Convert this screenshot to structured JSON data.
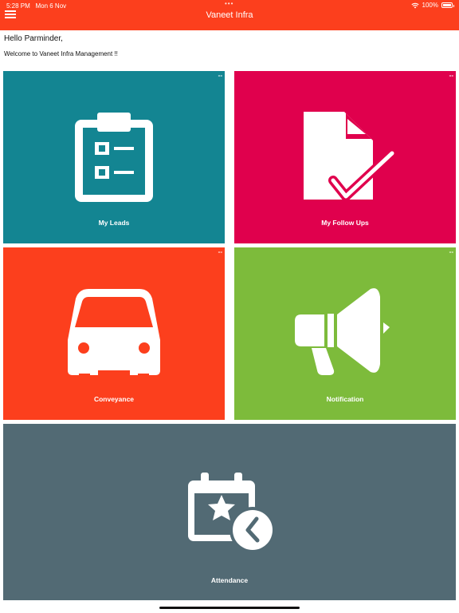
{
  "status_bar": {
    "time": "5:28 PM",
    "date": "Mon 6 Nov",
    "battery": "100%",
    "dots": "•••"
  },
  "header": {
    "title": "Vaneet Infra",
    "color": "#fc3f1d"
  },
  "greeting": {
    "hello": "Hello Parminder,",
    "welcome": "Welcome to Vaneet Infra Management !!"
  },
  "tiles": [
    {
      "label": "My Leads",
      "badge": "--",
      "color": "#138592",
      "icon": "clipboard-checklist-icon"
    },
    {
      "label": "My Follow Ups",
      "badge": "--",
      "color": "#e0004d",
      "icon": "document-check-icon"
    },
    {
      "label": "Conveyance",
      "badge": "--",
      "color": "#fc3f1d",
      "icon": "vehicle-icon"
    },
    {
      "label": "Notification",
      "badge": "--",
      "color": "#7dbb3b",
      "icon": "megaphone-icon"
    },
    {
      "label": "Attendance",
      "color": "#526a74",
      "icon": "calendar-clock-icon"
    }
  ]
}
